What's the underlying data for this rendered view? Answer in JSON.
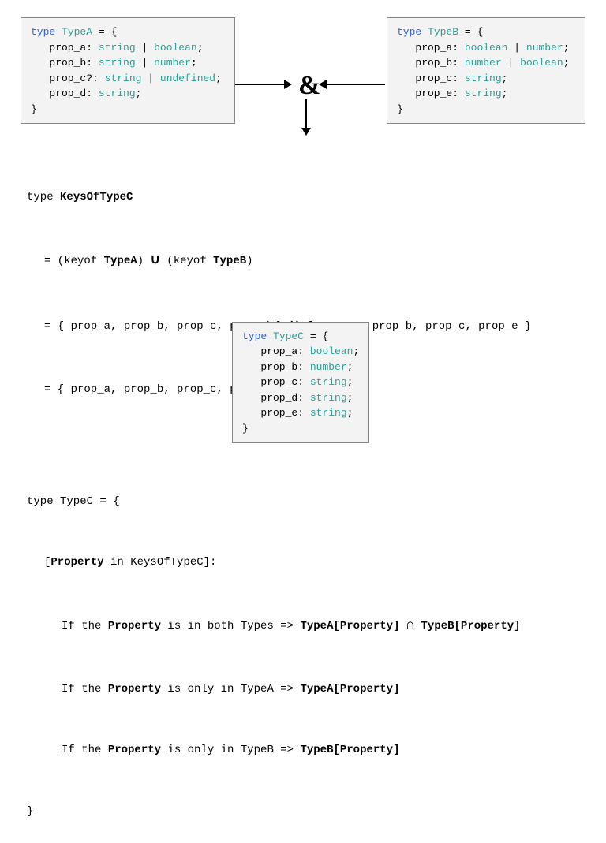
{
  "typeA": {
    "keyword": "type",
    "name": "TypeA",
    "lines": [
      {
        "prop": "prop_a",
        "opt": "",
        "types": [
          "string",
          "boolean"
        ]
      },
      {
        "prop": "prop_b",
        "opt": "",
        "types": [
          "string",
          "number"
        ]
      },
      {
        "prop": "prop_c",
        "opt": "?",
        "types": [
          "string",
          "undefined"
        ]
      },
      {
        "prop": "prop_d",
        "opt": "",
        "types": [
          "string"
        ]
      }
    ]
  },
  "typeB": {
    "keyword": "type",
    "name": "TypeB",
    "lines": [
      {
        "prop": "prop_a",
        "opt": "",
        "types": [
          "boolean",
          "number"
        ]
      },
      {
        "prop": "prop_b",
        "opt": "",
        "types": [
          "number",
          "boolean"
        ]
      },
      {
        "prop": "prop_c",
        "opt": "",
        "types": [
          "string"
        ]
      },
      {
        "prop": "prop_e",
        "opt": "",
        "types": [
          "string"
        ]
      }
    ]
  },
  "typeC": {
    "keyword": "type",
    "name": "TypeC",
    "lines": [
      {
        "prop": "prop_a",
        "opt": "",
        "types": [
          "boolean"
        ]
      },
      {
        "prop": "prop_b",
        "opt": "",
        "types": [
          "number"
        ]
      },
      {
        "prop": "prop_c",
        "opt": "",
        "types": [
          "string"
        ]
      },
      {
        "prop": "prop_d",
        "opt": "",
        "types": [
          "string"
        ]
      },
      {
        "prop": "prop_e",
        "opt": "",
        "types": [
          "string"
        ]
      }
    ]
  },
  "ampersand": "&",
  "mid": {
    "l1a": "type ",
    "l1b": "KeysOfTypeC",
    "l2a": "= (keyof ",
    "l2b": "TypeA",
    "l2c": ") ",
    "l2u": "∪",
    "l2d": " (keyof ",
    "l2e": "TypeB",
    "l2f": ")",
    "l3a": "= { prop_a, prop_b, prop_c, prop_d } ",
    "l3u": "∪",
    "l3b": " { prop_a, prop_b, prop_c, prop_e }",
    "l4": "= { prop_a, prop_b, prop_c, prop_d, prop_e }",
    "m1": "type TypeC = {",
    "m2a": "[",
    "m2b": "Property",
    "m2c": " in KeysOfTypeC]:",
    "r1a": "If the ",
    "r1b": "Property",
    "r1c": " is in both Types => ",
    "r1d": "TypeA[Property]",
    "r1e": " ",
    "r1f": "∩",
    "r1g": " ",
    "r1h": "TypeB[Property]",
    "r2a": "If the ",
    "r2b": "Property",
    "r2c": " is only in TypeA => ",
    "r2d": "TypeA[Property]",
    "r3a": "If the ",
    "r3b": "Property",
    "r3c": " is only in TypeB => ",
    "r3d": "TypeB[Property]",
    "close": "}"
  }
}
